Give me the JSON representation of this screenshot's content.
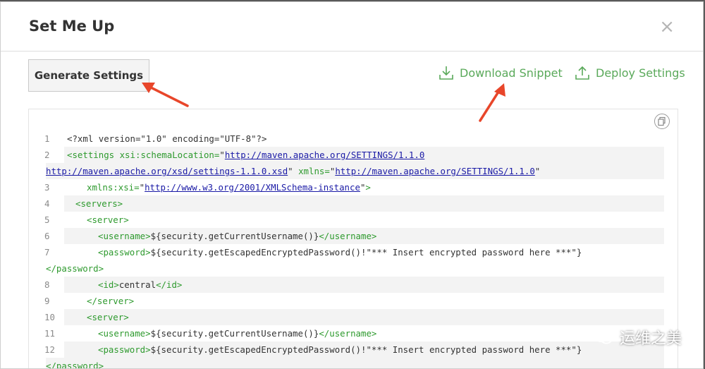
{
  "dialog": {
    "title": "Set Me Up",
    "close_label": "×"
  },
  "toolbar": {
    "generate_label": "Generate Settings",
    "download_label": "Download Snippet",
    "deploy_label": "Deploy Settings"
  },
  "code": {
    "line_numbers": [
      "1",
      "2",
      "3",
      "4",
      "5",
      "6",
      "7",
      "8",
      "9",
      "10",
      "11",
      "12"
    ],
    "l1": "<?xml version=\"1.0\" encoding=\"UTF-8\"?>",
    "l2_open": "<settings",
    "l2_attr1": " xsi:schemaLocation=",
    "l2_url1": "http://maven.apache.org/SETTINGS/1.1.0",
    "l2b_url2": "http://maven.apache.org/xsd/settings-1.1.0.xsd",
    "l2b_attr2": " xmlns=",
    "l2b_url3": "http://maven.apache.org/SETTINGS/1.1.0",
    "l3_attr": "xmlns:xsi=",
    "l3_url": "http://www.w3.org/2001/XMLSchema-instance",
    "l3_close": ">",
    "l4": "<servers>",
    "l5": "<server>",
    "username_open": "<username>",
    "username_value": "${security.getCurrentUsername()}",
    "username_close": "</username>",
    "password_open": "<password>",
    "password_value": "${security.getEscapedEncryptedPassword()!\"*** Insert encrypted password here ***\"}",
    "password_close": "</password>",
    "id_open": "<id>",
    "id_value": "central",
    "id_close": "</id>",
    "server_close": "</server>"
  },
  "watermark": {
    "text": "运维之美"
  },
  "colors": {
    "accent_green": "#5aa95a",
    "tag_green": "#2e9a2e",
    "link_blue": "#1a1aa6",
    "annotation_red": "#e8462a"
  }
}
